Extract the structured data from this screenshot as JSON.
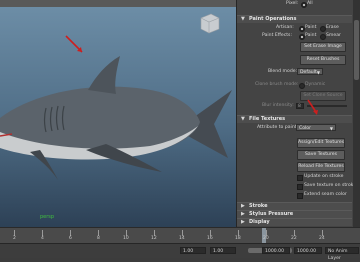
{
  "viewport": {
    "status_text": "persp"
  },
  "panel": {
    "pixel_row": {
      "label": "Pixel:",
      "value": "All"
    },
    "paint_operations": {
      "header": "Paint Operations",
      "artisan": {
        "label": "Artisan:",
        "opt1": "Paint",
        "opt2": "Erase"
      },
      "paint_effects": {
        "label": "Paint Effects:",
        "opt1": "Paint",
        "opt2": "Smear"
      },
      "set_erase_image": "Set Erase Image",
      "reset_brushes": "Reset Brushes",
      "blend_mode": {
        "label": "Blend mode:",
        "value": "Default"
      },
      "clone_brush_mode": {
        "label": "Clone brush mode:",
        "value": "Dynamic"
      },
      "set_clone_source": "Set Clone Source",
      "flow_intensity": {
        "label": "Blur intensity:",
        "value": "8"
      }
    },
    "file_textures": {
      "header": "File Textures",
      "attribute_to_paint": {
        "label": "Attribute to paint:",
        "value": "Color"
      },
      "assign_edit": "Assign/Edit Textures",
      "save": "Save Textures",
      "reload": "Reload File Textures",
      "update_on_stroke": "Update on stroke",
      "save_texture_on_stroke": "Save texture on stroke",
      "extend_seam_color": "Extend seam color"
    },
    "collapsed": [
      "Stroke",
      "Stylus Pressure",
      "Display"
    ]
  },
  "timeline": {
    "ticks": [
      "2",
      "4",
      "6",
      "8",
      "10",
      "12",
      "14",
      "16",
      "18",
      "20",
      "22",
      "24"
    ]
  },
  "range": {
    "start": "1.00",
    "inner_start": "1.00",
    "inner_end": "1000.00",
    "end": "1000.00",
    "layer": "No Anim Layer"
  },
  "colors": {
    "accent_arrow": "#cc1f1f",
    "viewport_top": "#6e8fa8",
    "viewport_bottom": "#2d4156"
  }
}
